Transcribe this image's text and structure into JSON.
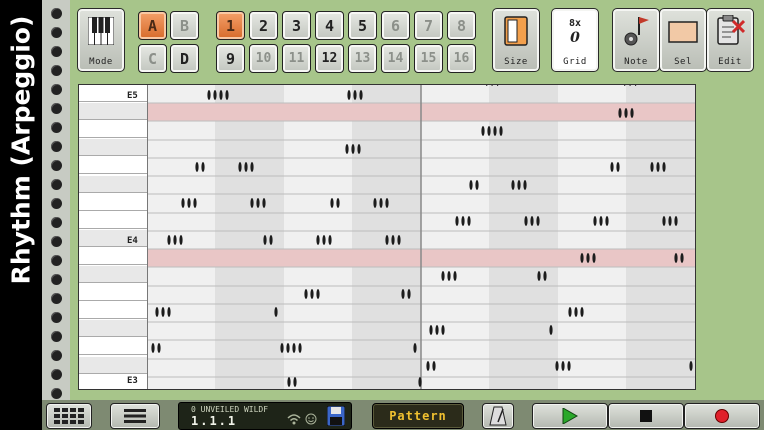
{
  "side_title": "Rhythm (Arpeggio)",
  "toolbar": {
    "mode_label": "Mode",
    "size_label": "Size",
    "grid_label": "Grid",
    "grid_value_top": "8x",
    "grid_value_bottom": "0",
    "note_label": "Note",
    "sel_label": "Sel",
    "edit_label": "Edit"
  },
  "bank_keys": [
    "A",
    "B",
    "C",
    "D"
  ],
  "pattern_keys": [
    "1",
    "2",
    "3",
    "4",
    "5",
    "6",
    "7",
    "8",
    "9",
    "10",
    "11",
    "12",
    "13",
    "14",
    "15",
    "16"
  ],
  "roll": {
    "labels": {
      "e5": "E5",
      "e4": "E4",
      "e3": "E3"
    },
    "top_marker": "...",
    "top_marker2": "..."
  },
  "bottom": {
    "song_name": "0 UNVEILED WILDF",
    "position": "1.1.1",
    "mode_button": "Pattern"
  },
  "colors": {
    "accent": "#e07a3a",
    "panel": "#a7c58a",
    "highlight_row": "#e9c6c6"
  }
}
